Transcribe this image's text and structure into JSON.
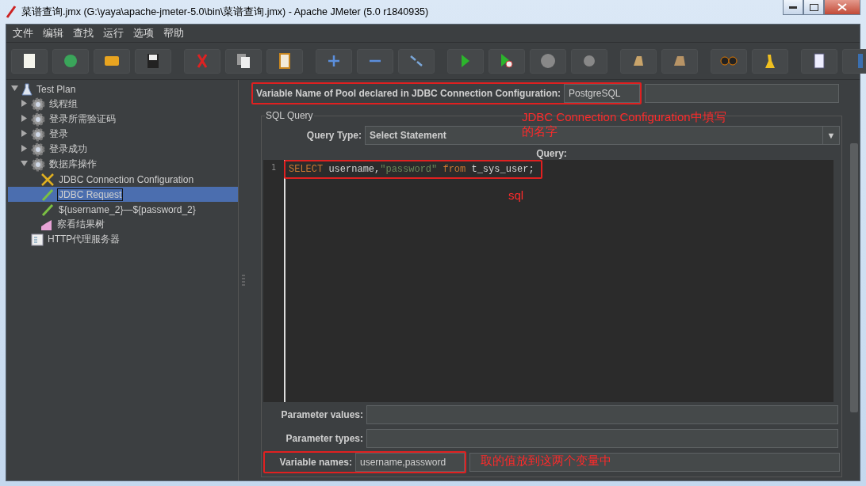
{
  "window": {
    "title": "菜谱查询.jmx (G:\\yaya\\apache-jmeter-5.0\\bin\\菜谱查询.jmx) - Apache JMeter (5.0 r1840935)"
  },
  "menu": [
    "文件",
    "编辑",
    "查找",
    "运行",
    "选项",
    "帮助"
  ],
  "tree": [
    {
      "label": "Test Plan",
      "kind": "plan",
      "expanded": true,
      "selected": false,
      "children": [
        {
          "label": "线程组",
          "kind": "group",
          "expanded": false,
          "selected": false
        },
        {
          "label": "登录所需验证码",
          "kind": "group",
          "expanded": false,
          "selected": false
        },
        {
          "label": "登录",
          "kind": "group",
          "expanded": false,
          "selected": false
        },
        {
          "label": "登录成功",
          "kind": "group",
          "expanded": false,
          "selected": false
        },
        {
          "label": "数据库操作",
          "kind": "group",
          "expanded": true,
          "selected": false,
          "children": [
            {
              "label": "JDBC Connection Configuration",
              "kind": "config",
              "selected": false
            },
            {
              "label": "JDBC Request",
              "kind": "sampler",
              "selected": true
            },
            {
              "label": "${username_2}—${password_2}",
              "kind": "sampler",
              "selected": false
            },
            {
              "label": "察看结果树",
              "kind": "listener",
              "selected": false
            }
          ]
        },
        {
          "label": "HTTP代理服务器",
          "kind": "proxy",
          "selected": false
        }
      ]
    }
  ],
  "pool": {
    "label": "Variable Name of Pool declared in JDBC Connection Configuration:",
    "value": "PostgreSQL",
    "highlighted": true
  },
  "sql_query": {
    "title": "SQL Query",
    "query_type": {
      "label": "Query Type:",
      "value": "Select Statement",
      "arrow": "▼"
    },
    "query_label": "Query:",
    "line_number": "1",
    "highlighted": true,
    "tokens": [
      {
        "kind": "keyword",
        "text": "SELECT"
      },
      {
        "kind": "plain",
        "text": " username,"
      },
      {
        "kind": "string",
        "text": "\"password\""
      },
      {
        "kind": "keyword",
        "text": " from"
      },
      {
        "kind": "plain",
        "text": " t_sys_user;"
      }
    ],
    "params": [
      {
        "label": "Parameter values:",
        "highlighted": false
      },
      {
        "label": "Parameter types:",
        "highlighted": false
      },
      {
        "label": "Variable names:",
        "value": "username,password",
        "highlighted": true
      }
    ]
  },
  "annotations": [
    {
      "kind": "pool",
      "lines": [
        "JDBC Connection Configuration中填写",
        "的名字"
      ]
    },
    {
      "kind": "sql",
      "text": "sql"
    },
    {
      "kind": "vars",
      "text": "取的值放到这两个变量中"
    }
  ]
}
